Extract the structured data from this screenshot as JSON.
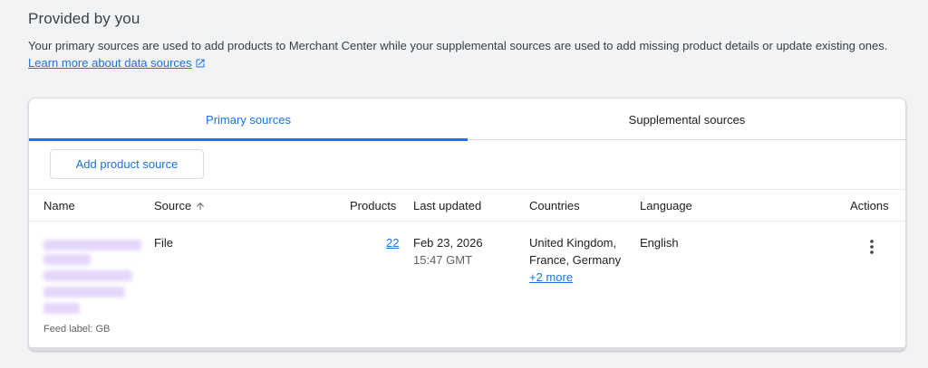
{
  "header": {
    "title": "Provided by you",
    "description": "Your primary sources are used to add products to Merchant Center while your supplemental sources are used to add missing product details or update existing ones.",
    "learn_more_link": "Learn more about data sources"
  },
  "tabs": [
    {
      "label": "Primary sources",
      "active": true
    },
    {
      "label": "Supplemental sources",
      "active": false
    }
  ],
  "actions": {
    "add_source_label": "Add product source"
  },
  "table": {
    "columns": [
      "Name",
      "Source",
      "Products",
      "Last updated",
      "Countries",
      "Language",
      "Actions"
    ],
    "sort_icon": "arrow-up-icon",
    "rows": [
      {
        "name": "",
        "feed_label": "Feed label: GB",
        "source": "File",
        "products": "22",
        "last_updated_date": "Feb 23, 2026",
        "last_updated_time": "15:47 GMT",
        "countries_line1": "United Kingdom,",
        "countries_line2": "France, Germany",
        "countries_more": "+2 more",
        "language": "English",
        "actions_icon": "more-vert-icon"
      }
    ]
  },
  "colors": {
    "accent": "#1a73e8",
    "text": "#202124",
    "muted": "#5f6368",
    "border": "#dadce0",
    "background": "#f1f3f4"
  }
}
